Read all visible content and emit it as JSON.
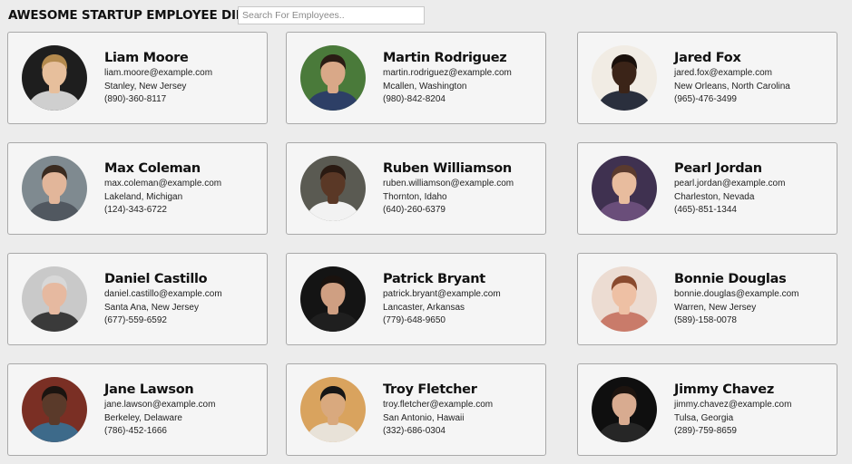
{
  "header": {
    "title": "AWESOME STARTUP EMPLOYEE DIRECTORY",
    "search_placeholder": "Search For Employees.."
  },
  "employees": [
    {
      "name": "Liam Moore",
      "email": "liam.moore@example.com",
      "location": "Stanley, New Jersey",
      "phone": "(890)-360-8117",
      "avatar": {
        "bg": "#1e1e1e",
        "skin": "#e7bf9c",
        "hair": "#b48a4e",
        "shirt": "#cfcfcf"
      }
    },
    {
      "name": "Martin Rodriguez",
      "email": "martin.rodriguez@example.com",
      "location": "Mcallen, Washington",
      "phone": "(980)-842-8204",
      "avatar": {
        "bg": "#4a7a3a",
        "skin": "#d9a888",
        "hair": "#2a1c14",
        "shirt": "#2d3f66"
      }
    },
    {
      "name": "Jared Fox",
      "email": "jared.fox@example.com",
      "location": "New Orleans, North Carolina",
      "phone": "(965)-476-3499",
      "avatar": {
        "bg": "#f1ece4",
        "skin": "#3b2418",
        "hair": "#1a100b",
        "shirt": "#2a2f3d"
      }
    },
    {
      "name": "Max Coleman",
      "email": "max.coleman@example.com",
      "location": "Lakeland, Michigan",
      "phone": "(124)-343-6722",
      "avatar": {
        "bg": "#7f8a90",
        "skin": "#e2b69a",
        "hair": "#3a2b20",
        "shirt": "#515860"
      }
    },
    {
      "name": "Ruben Williamson",
      "email": "ruben.williamson@example.com",
      "location": "Thornton, Idaho",
      "phone": "(640)-260-6379",
      "avatar": {
        "bg": "#5a5a52",
        "skin": "#5a3826",
        "hair": "#2a1a12",
        "shirt": "#f2f2f2"
      }
    },
    {
      "name": "Pearl Jordan",
      "email": "pearl.jordan@example.com",
      "location": "Charleston, Nevada",
      "phone": "(465)-851-1344",
      "avatar": {
        "bg": "#3f3150",
        "skin": "#e8bc9e",
        "hair": "#5a3a2e",
        "shirt": "#6a4e7a"
      }
    },
    {
      "name": "Daniel Castillo",
      "email": "daniel.castillo@example.com",
      "location": "Santa Ana, New Jersey",
      "phone": "(677)-559-6592",
      "avatar": {
        "bg": "#c9c9c9",
        "skin": "#e6b9a0",
        "hair": "#d8d8d8",
        "shirt": "#3a3a3a"
      }
    },
    {
      "name": "Patrick Bryant",
      "email": "patrick.bryant@example.com",
      "location": "Lancaster, Arkansas",
      "phone": "(779)-648-9650",
      "avatar": {
        "bg": "#141414",
        "skin": "#cf9f82",
        "hair": "#1a120e",
        "shirt": "#1f1f1f"
      }
    },
    {
      "name": "Bonnie Douglas",
      "email": "bonnie.douglas@example.com",
      "location": "Warren, New Jersey",
      "phone": "(589)-158-0078",
      "avatar": {
        "bg": "#ecdcd2",
        "skin": "#eec0a4",
        "hair": "#8a4a2e",
        "shirt": "#c97b6a"
      }
    },
    {
      "name": "Jane Lawson",
      "email": "jane.lawson@example.com",
      "location": "Berkeley, Delaware",
      "phone": "(786)-452-1666",
      "avatar": {
        "bg": "#7a2f24",
        "skin": "#5a3a2a",
        "hair": "#1b1410",
        "shirt": "#3d6a8a"
      }
    },
    {
      "name": "Troy Fletcher",
      "email": "troy.fletcher@example.com",
      "location": "San Antonio, Hawaii",
      "phone": "(332)-686-0304",
      "avatar": {
        "bg": "#d9a35e",
        "skin": "#d9a97e",
        "hair": "#161616",
        "shirt": "#e8e2d8"
      }
    },
    {
      "name": "Jimmy Chavez",
      "email": "jimmy.chavez@example.com",
      "location": "Tulsa, Georgia",
      "phone": "(289)-759-8659",
      "avatar": {
        "bg": "#0f0f0f",
        "skin": "#d8ab90",
        "hair": "#1d140f",
        "shirt": "#262626"
      }
    }
  ]
}
